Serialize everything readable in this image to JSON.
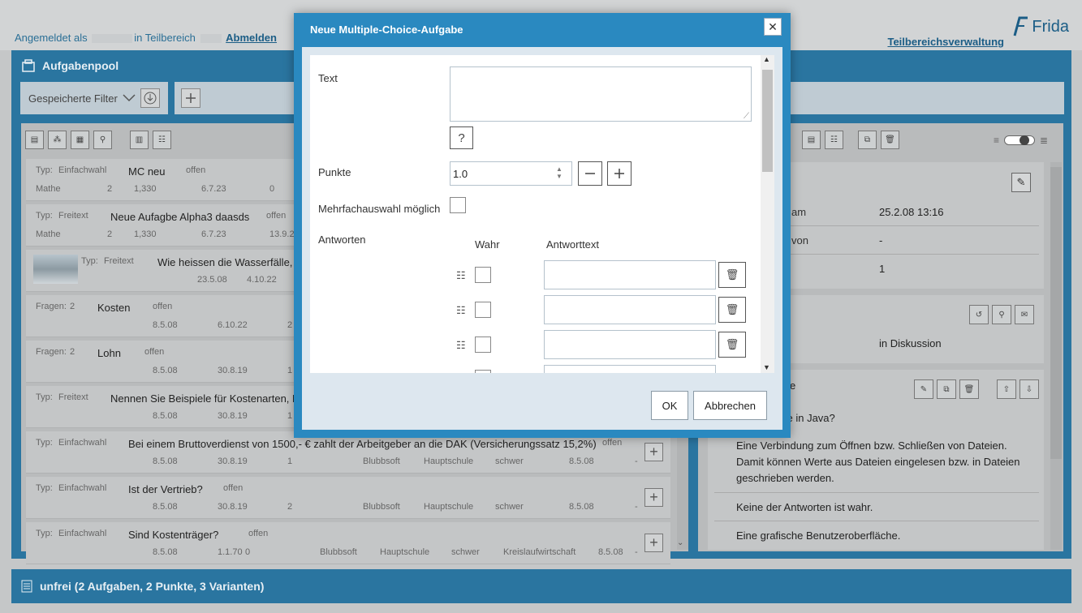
{
  "header": {
    "logged_in_prefix": "Angemeldet als",
    "in_area": "in Teilbereich",
    "logout": "Abmelden",
    "area_admin": "Teilbereichsverwaltung",
    "logo": "Frida"
  },
  "pool": {
    "title": "Aufgabenpool",
    "saved_filters": "Gespeicherte Filter"
  },
  "rows": [
    {
      "type": "Typ:",
      "kind": "Einfachwahl",
      "title": "MC neu",
      "status": "offen",
      "sub": [
        "Mathe",
        "2",
        "1,330",
        "6.7.23",
        "0"
      ]
    },
    {
      "type": "Typ:",
      "kind": "Freitext",
      "title": "Neue Aufagbe Alpha3 daasds",
      "status": "offen",
      "sub": [
        "Mathe",
        "2",
        "1,330",
        "6.7.23",
        "13.9.23"
      ]
    },
    {
      "type": "Typ:",
      "kind": "Freitext",
      "title": "Wie heissen die Wasserfälle, di",
      "status": "",
      "sub": [
        "23.5.08",
        "4.10.22"
      ]
    },
    {
      "type": "Fragen:",
      "kind": "2",
      "title": "Kosten",
      "status": "offen",
      "sub": [
        "8.5.08",
        "6.10.22",
        "2"
      ]
    },
    {
      "type": "Fragen:",
      "kind": "2",
      "title": "Lohn",
      "status": "offen",
      "sub": [
        "8.5.08",
        "30.8.19",
        "1"
      ]
    },
    {
      "type": "Typ:",
      "kind": "Freitext",
      "title": "Nennen Sie Beispiele für Kostenarten, Ko",
      "status": "",
      "sub": [
        "8.5.08",
        "30.8.19",
        "1"
      ]
    },
    {
      "type": "Typ:",
      "kind": "Einfachwahl",
      "title": "Bei einem Bruttoverdienst von 1500,- € zahlt der Arbeitgeber an die DAK (Versicherungssatz 15,2%)",
      "status": "offen",
      "sub": [
        "8.5.08",
        "30.8.19",
        "1",
        "Blubbsoft",
        "Hauptschule",
        "schwer",
        "8.5.08",
        "-"
      ]
    },
    {
      "type": "Typ:",
      "kind": "Einfachwahl",
      "title": "Ist der Vertrieb?",
      "status": "offen",
      "sub": [
        "8.5.08",
        "30.8.19",
        "2",
        "Blubbsoft",
        "Hauptschule",
        "schwer",
        "8.5.08",
        "-"
      ]
    },
    {
      "type": "Typ:",
      "kind": "Einfachwahl",
      "title": "Sind Kostenträger?",
      "status": "offen",
      "sub": [
        "8.5.08",
        "1.1.70",
        "0",
        "Blubbsoft",
        "Hauptschule",
        "schwer",
        "Kreislaufwirtschaft",
        "8.5.08",
        "-"
      ]
    }
  ],
  "detail": {
    "am_label": "am",
    "am_value": "25.2.08 13:16",
    "von_label": "von",
    "von_value": "-",
    "count_value": "1",
    "status_value": "in Diskussion",
    "section_e": "e",
    "question_frag": "ce in Java?",
    "answers": [
      "Eine Verbindung zum Öffnen bzw. Schließen von Dateien. Damit können Werte aus Dateien eingelesen bzw. in Dateien geschrieben werden.",
      "Keine der Antworten ist wahr.",
      "Eine grafische Benutzeroberfläche."
    ]
  },
  "footer": {
    "label": "unfrei (2 Aufgaben, 2 Punkte, 3 Varianten)"
  },
  "modal": {
    "title": "Neue Multiple-Choice-Aufgabe",
    "text_label": "Text",
    "help": "?",
    "points_label": "Punkte",
    "points_value": "1.0",
    "multi_label": "Mehrfachauswahl möglich",
    "answers_label": "Antworten",
    "col_true": "Wahr",
    "col_text": "Antworttext",
    "ok": "OK",
    "cancel": "Abbrechen"
  }
}
